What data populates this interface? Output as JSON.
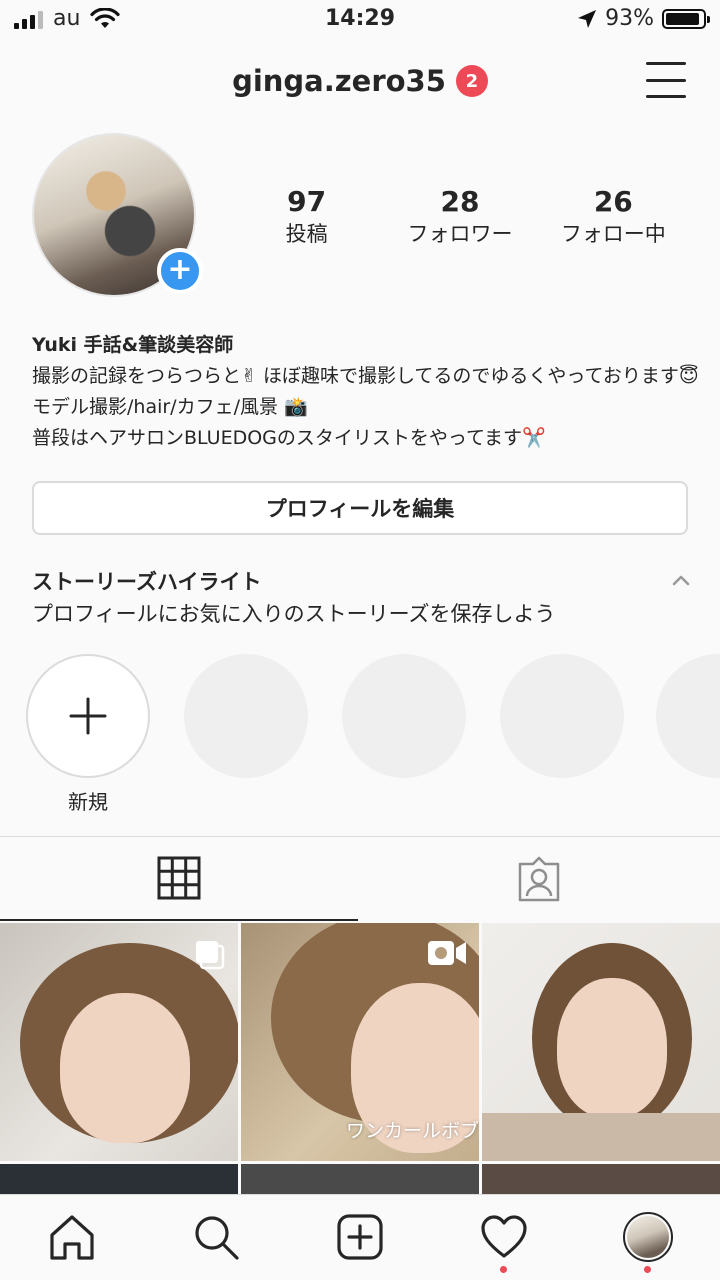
{
  "status_bar": {
    "carrier": "au",
    "time": "14:29",
    "battery": "93%",
    "battery_level": 0.93
  },
  "header": {
    "username": "ginga.zero35",
    "notification_count": "2",
    "menu_icon": "hamburger-menu-icon"
  },
  "profile": {
    "stats": [
      {
        "value": "97",
        "label": "投稿"
      },
      {
        "value": "28",
        "label": "フォロワー"
      },
      {
        "value": "26",
        "label": "フォロー中"
      }
    ],
    "bio": {
      "name": "Yuki  手話&筆談美容師",
      "lines": [
        "撮影の記録をつらつらと✌ ほぼ趣味で撮影してるのでゆるくやっております😇",
        "モデル撮影/hair/カフェ/風景 📸",
        "普段はヘアサロンBLUEDOGのスタイリストをやってます✂️"
      ]
    },
    "edit_button_label": "プロフィールを編集"
  },
  "highlights": {
    "title": "ストーリーズハイライト",
    "subtitle": "プロフィールにお気に入りのストーリーズを保存しよう",
    "new_label": "新規"
  },
  "posts": {
    "caption_2": "ワンカールボブ"
  },
  "colors": {
    "accent": "#3897f0",
    "badge": "#ed4956",
    "text": "#262626",
    "border": "#dbdbdb"
  }
}
